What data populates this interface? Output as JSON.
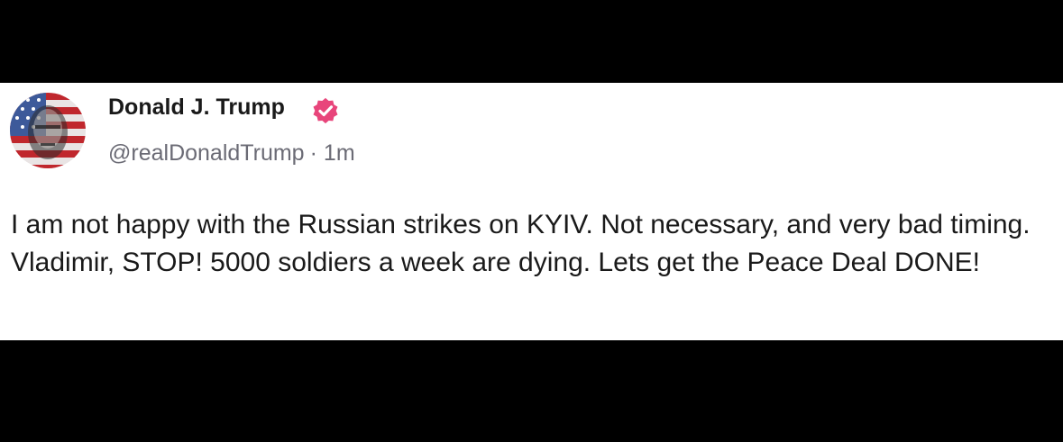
{
  "author": {
    "display_name": "Donald J. Trump",
    "handle": "@realDonaldTrump",
    "timestamp": "1m",
    "avatar_icon": "flag-portrait-avatar",
    "verified_icon": "verified-badge-icon"
  },
  "meta_separator": "·",
  "post": {
    "text": "I am not happy with the Russian strikes on KYIV. Not necessary, and very bad timing. Vladimir, STOP! 5000 soldiers a week are dying. Lets get the Peace Deal DONE!"
  },
  "colors": {
    "verified": "#e8457b",
    "background": "#ffffff",
    "frame": "#000000",
    "text": "#1a1a1a",
    "secondary_text": "#6b6b75"
  }
}
